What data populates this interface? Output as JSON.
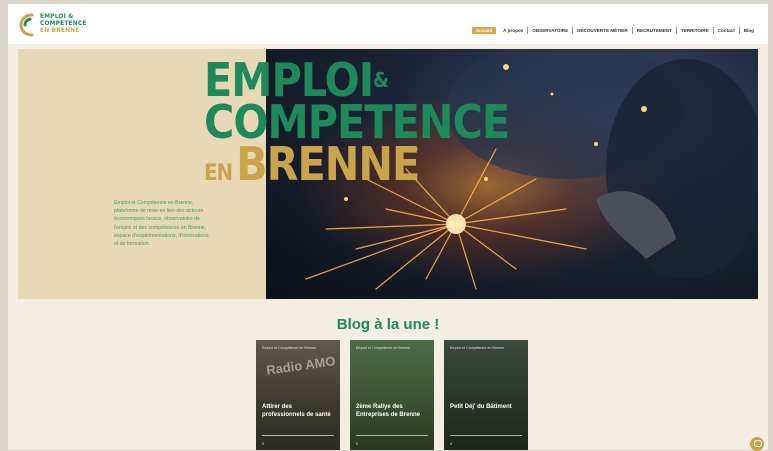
{
  "logo": {
    "line1": "EMPLOI &",
    "line2": "COMPETENCE",
    "line3": "EN BRENNE"
  },
  "nav": {
    "items": [
      {
        "label": "Accueil",
        "active": true
      },
      {
        "label": "À propos"
      },
      {
        "label": "OBSERVATOIRE"
      },
      {
        "label": "DÉCOUVERTE MÉTIER"
      },
      {
        "label": "RECRUTEMENT"
      },
      {
        "label": "TERRITOIRE"
      },
      {
        "label": "Contact"
      },
      {
        "label": "Blog"
      }
    ]
  },
  "hero": {
    "title_line1": "EMPLOI",
    "title_amp": "&",
    "title_line2": "COMPETENCE",
    "title_en": "EN",
    "title_line3": "BRENNE",
    "description": "Emploi et Compétence en Brenne, plateforme de mise en lien des acteurs économiques locaux, observatoire de l'emploi et des compétences en Brenne, espace d'expérimentations, d'innovations et de formation."
  },
  "blog": {
    "heading": "Blog à la une !",
    "cards": [
      {
        "meta": "Emploi et Compétence en Brenne",
        "title": "Attirer des professionnels de santé",
        "foot": "0",
        "sign": "Radio AMO"
      },
      {
        "meta": "Emploi et Compétence en Brenne",
        "title": "2ème Rallye des Entreprises de Brenne",
        "foot": "0"
      },
      {
        "meta": "Emploi et Compétence en Brenne",
        "title": "Petit Déj' du Bâtiment",
        "foot": "0"
      }
    ]
  },
  "colors": {
    "green": "#1e8a5c",
    "gold": "#c9a44a",
    "sand": "#e8d8b5"
  }
}
